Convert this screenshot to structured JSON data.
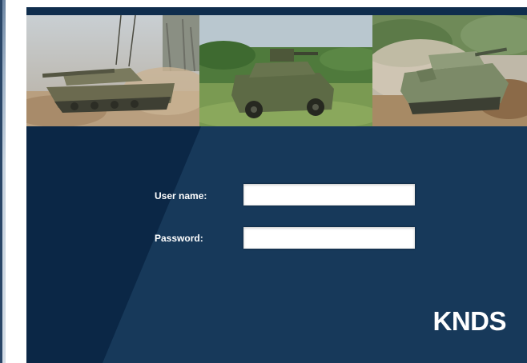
{
  "login": {
    "username_label": "User name:",
    "username_value": "",
    "password_label": "Password:",
    "password_value": ""
  },
  "branding": {
    "logo_text": "KNDS"
  },
  "photos": [
    {
      "name": "tank-photo",
      "icon": "main-battle-tank-image"
    },
    {
      "name": "armored-car-photo",
      "icon": "armored-reconnaissance-vehicle-image"
    },
    {
      "name": "ifv-photo",
      "icon": "infantry-fighting-vehicle-image"
    }
  ],
  "colors": {
    "panel_background": "#17395a",
    "panel_dark": "#0b2746",
    "label_text": "#ffffff",
    "input_background": "#ffffff"
  }
}
